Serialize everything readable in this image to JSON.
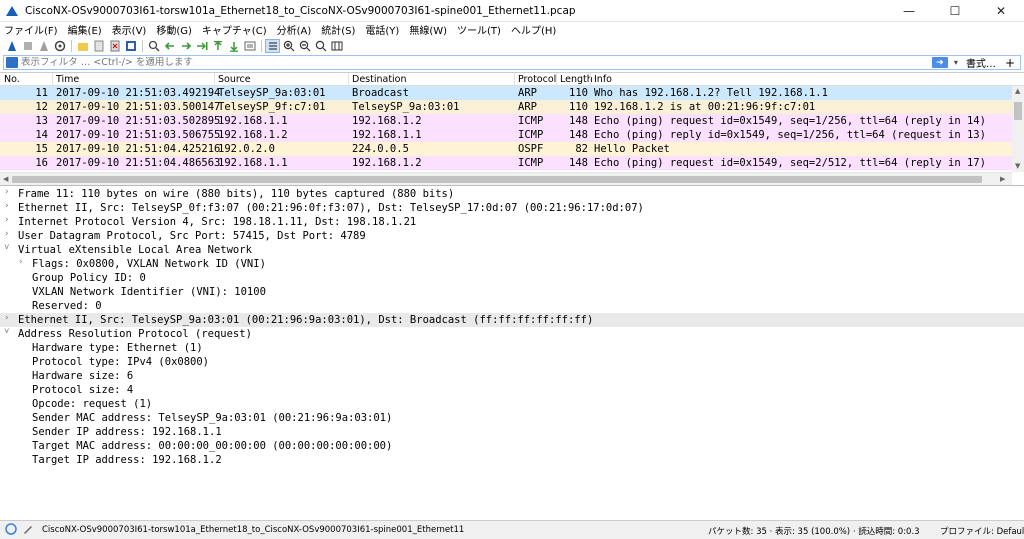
{
  "window": {
    "title": "CiscoNX-OSv9000703I61-torsw101a_Ethernet18_to_CiscoNX-OSv9000703I61-spine001_Ethernet11.pcap"
  },
  "menu": [
    "ファイル(F)",
    "編集(E)",
    "表示(V)",
    "移動(G)",
    "キャプチャ(C)",
    "分析(A)",
    "統計(S)",
    "電話(Y)",
    "無線(W)",
    "ツール(T)",
    "ヘルプ(H)"
  ],
  "filter": {
    "placeholder": "表示フィルタ … <Ctrl-/> を適用します",
    "expression_label": "書式…",
    "plus": "+"
  },
  "columns": {
    "no": "No.",
    "time": "Time",
    "source": "Source",
    "destination": "Destination",
    "protocol": "Protocol",
    "length": "Length",
    "info": "Info"
  },
  "packets": [
    {
      "no": "11",
      "time": "2017-09-10 21:51:03.492194",
      "source": "TelseySP_9a:03:01",
      "destination": "Broadcast",
      "protocol": "ARP",
      "length": "110",
      "info": "Who has 192.168.1.2? Tell 192.168.1.1",
      "color": "#faf0d7",
      "selected": true
    },
    {
      "no": "12",
      "time": "2017-09-10 21:51:03.500147",
      "source": "TelseySP_9f:c7:01",
      "destination": "TelseySP_9a:03:01",
      "protocol": "ARP",
      "length": "110",
      "info": "192.168.1.2 is at 00:21:96:9f:c7:01",
      "color": "#faf0d7"
    },
    {
      "no": "13",
      "time": "2017-09-10 21:51:03.502895",
      "source": "192.168.1.1",
      "destination": "192.168.1.2",
      "protocol": "ICMP",
      "length": "148",
      "info": "Echo (ping) request  id=0x1549, seq=1/256, ttl=64 (reply in 14)",
      "color": "#fce0ff"
    },
    {
      "no": "14",
      "time": "2017-09-10 21:51:03.506755",
      "source": "192.168.1.2",
      "destination": "192.168.1.1",
      "protocol": "ICMP",
      "length": "148",
      "info": "Echo (ping) reply    id=0x1549, seq=1/256, ttl=64 (request in 13)",
      "color": "#fce0ff"
    },
    {
      "no": "15",
      "time": "2017-09-10 21:51:04.425216",
      "source": "192.0.2.0",
      "destination": "224.0.0.5",
      "protocol": "OSPF",
      "length": "82",
      "info": "Hello Packet",
      "color": "#fff3d6"
    },
    {
      "no": "16",
      "time": "2017-09-10 21:51:04.486563",
      "source": "192.168.1.1",
      "destination": "192.168.1.2",
      "protocol": "ICMP",
      "length": "148",
      "info": "Echo (ping) request  id=0x1549, seq=2/512, ttl=64 (reply in 17)",
      "color": "#fce0ff"
    }
  ],
  "details": [
    {
      "indent": 0,
      "toggle": "›",
      "text": "Frame 11: 110 bytes on wire (880 bits), 110 bytes captured (880 bits)"
    },
    {
      "indent": 0,
      "toggle": "›",
      "text": "Ethernet II, Src: TelseySP_0f:f3:07 (00:21:96:0f:f3:07), Dst: TelseySP_17:0d:07 (00:21:96:17:0d:07)"
    },
    {
      "indent": 0,
      "toggle": "›",
      "text": "Internet Protocol Version 4, Src: 198.18.1.11, Dst: 198.18.1.21"
    },
    {
      "indent": 0,
      "toggle": "›",
      "text": "User Datagram Protocol, Src Port: 57415, Dst Port: 4789"
    },
    {
      "indent": 0,
      "toggle": "˅",
      "text": "Virtual eXtensible Local Area Network"
    },
    {
      "indent": 1,
      "toggle": "›",
      "text": "Flags: 0x0800, VXLAN Network ID (VNI)"
    },
    {
      "indent": 1,
      "toggle": "",
      "text": "Group Policy ID: 0"
    },
    {
      "indent": 1,
      "toggle": "",
      "text": "VXLAN Network Identifier (VNI): 10100"
    },
    {
      "indent": 1,
      "toggle": "",
      "text": "Reserved: 0"
    },
    {
      "indent": 0,
      "toggle": "›",
      "text": "Ethernet II, Src: TelseySP_9a:03:01 (00:21:96:9a:03:01), Dst: Broadcast (ff:ff:ff:ff:ff:ff)",
      "highlight": true
    },
    {
      "indent": 0,
      "toggle": "˅",
      "text": "Address Resolution Protocol (request)"
    },
    {
      "indent": 1,
      "toggle": "",
      "text": "Hardware type: Ethernet (1)"
    },
    {
      "indent": 1,
      "toggle": "",
      "text": "Protocol type: IPv4 (0x0800)"
    },
    {
      "indent": 1,
      "toggle": "",
      "text": "Hardware size: 6"
    },
    {
      "indent": 1,
      "toggle": "",
      "text": "Protocol size: 4"
    },
    {
      "indent": 1,
      "toggle": "",
      "text": "Opcode: request (1)"
    },
    {
      "indent": 1,
      "toggle": "",
      "text": "Sender MAC address: TelseySP_9a:03:01 (00:21:96:9a:03:01)"
    },
    {
      "indent": 1,
      "toggle": "",
      "text": "Sender IP address: 192.168.1.1"
    },
    {
      "indent": 1,
      "toggle": "",
      "text": "Target MAC address: 00:00:00_00:00:00 (00:00:00:00:00:00)"
    },
    {
      "indent": 1,
      "toggle": "",
      "text": "Target IP address: 192.168.1.2"
    }
  ],
  "status": {
    "file": "CiscoNX-OSv9000703I61-torsw101a_Ethernet18_to_CiscoNX-OSv9000703I61-spine001_Ethernet11",
    "packets": "パケット数: 35 · 表示: 35 (100.0%) · 読込時間: 0:0.3",
    "profile": "プロファイル: Default"
  },
  "colors": {
    "accent": "#3c7fd6",
    "selected_row": "#cce8ff",
    "arp": "#faf0d7",
    "icmp": "#fce0ff",
    "ospf": "#fff3d6"
  }
}
